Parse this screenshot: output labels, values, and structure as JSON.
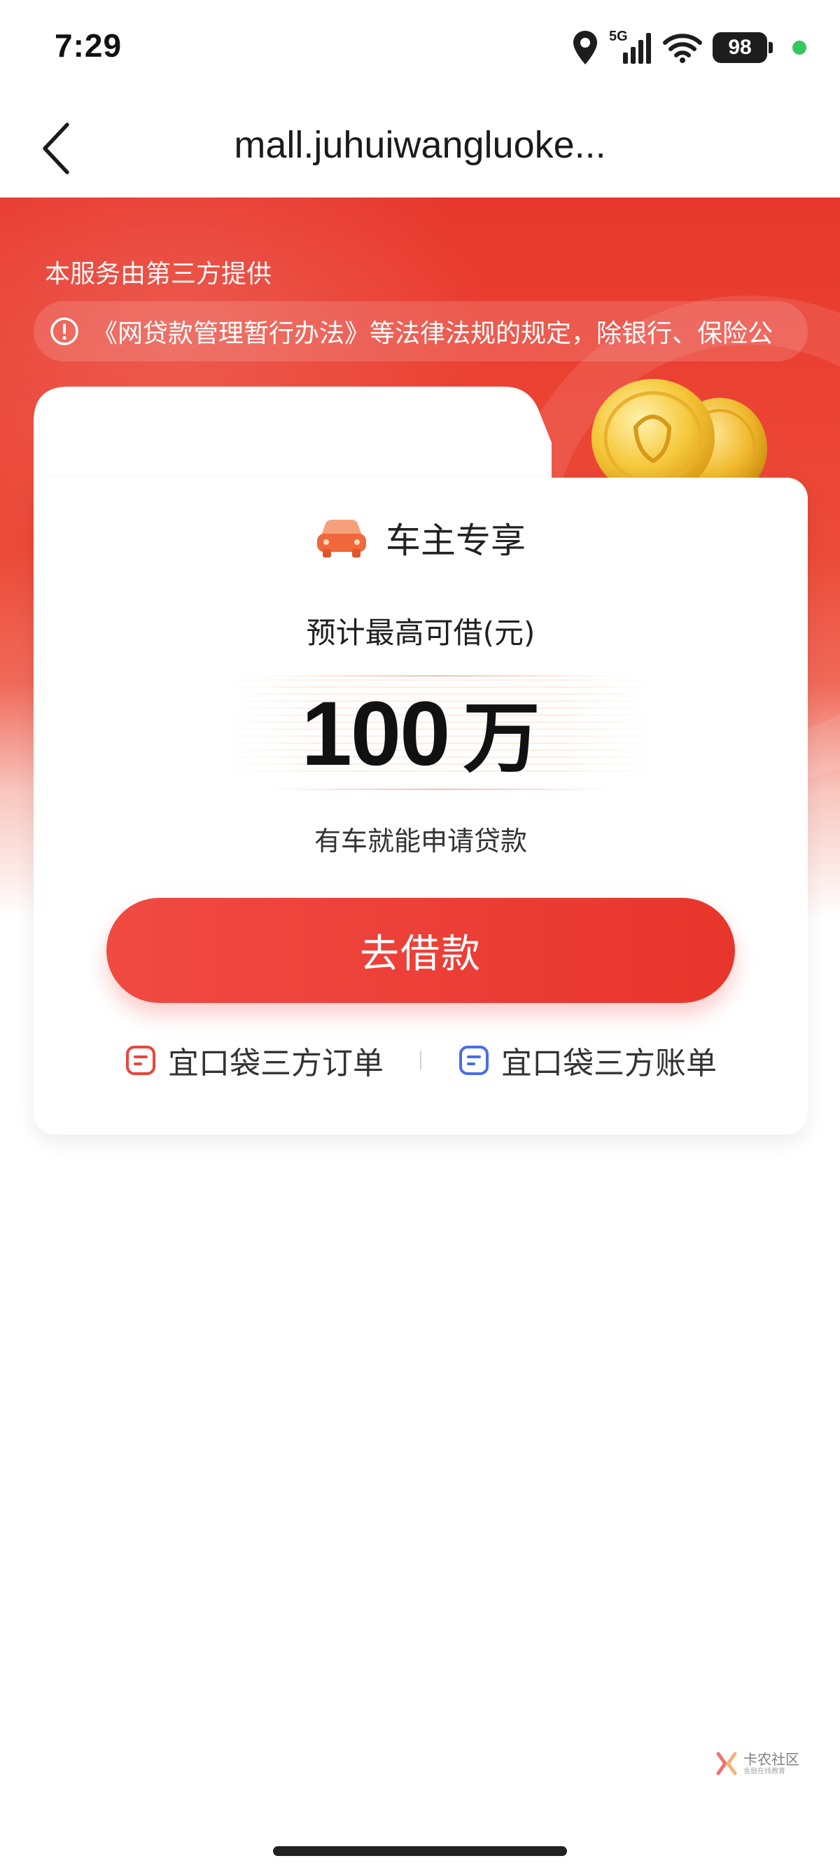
{
  "status_bar": {
    "time": "7:29",
    "network": "5G",
    "battery": "98",
    "icons": [
      "location-icon",
      "cellular-signal-icon",
      "wifi-icon",
      "battery-icon",
      "green-dot-indicator"
    ]
  },
  "nav": {
    "title": "mall.juhuiwangluoke...",
    "back_icon": "chevron-left-icon"
  },
  "hero": {
    "provider_note": "本服务由第三方提供",
    "notice_text": "《网贷款管理暂行办法》等法律法规的规定，除银行、保险公",
    "notice_icon": "info-circle-icon"
  },
  "card": {
    "header_icon": "car-icon",
    "header_label": "车主专享",
    "loan_label": "预计最高可借(元)",
    "amount_number": "100",
    "amount_unit": "万",
    "sub_label": "有车就能申请贷款",
    "cta_label": "去借款",
    "links": [
      {
        "label": "宜口袋三方订单",
        "icon": "order-doc-icon",
        "color": "#e8463c"
      },
      {
        "label": "宜口袋三方账单",
        "icon": "bill-doc-icon",
        "color": "#4a6de5"
      }
    ]
  },
  "watermark": {
    "main": "卡农社区",
    "sub": "金融在线教育"
  },
  "colors": {
    "brand_red": "#e8352c",
    "accent_blue": "#4a6de5",
    "status_green": "#34c759"
  }
}
